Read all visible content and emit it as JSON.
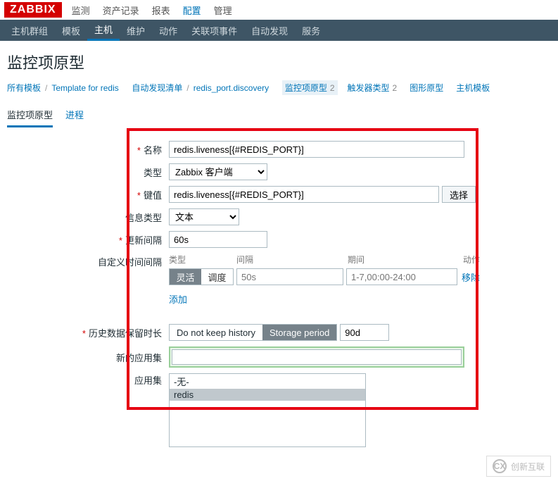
{
  "logo": "ZABBIX",
  "top_menu": [
    "监测",
    "资产记录",
    "报表",
    "配置",
    "管理"
  ],
  "top_menu_active": 3,
  "sub_menu": [
    "主机群组",
    "模板",
    "主机",
    "维护",
    "动作",
    "关联项事件",
    "自动发现",
    "服务"
  ],
  "sub_menu_active": 2,
  "page_title": "监控项原型",
  "breadcrumb": {
    "all_templates": "所有模板",
    "template": "Template for redis",
    "discovery_list": "自动发现清单",
    "discovery_rule": "redis_port.discovery",
    "pills": [
      {
        "label": "监控项原型",
        "count": "2",
        "active": true
      },
      {
        "label": "触发器类型",
        "count": "2",
        "active": false
      },
      {
        "label": "图形原型",
        "count": "",
        "active": false
      },
      {
        "label": "主机模板",
        "count": "",
        "active": false
      }
    ]
  },
  "tabs": [
    "监控项原型",
    "进程"
  ],
  "tabs_active": 0,
  "form": {
    "name_label": "名称",
    "name_value": "redis.liveness[{#REDIS_PORT}]",
    "type_label": "类型",
    "type_value": "Zabbix 客户端",
    "key_label": "键值",
    "key_value": "redis.liveness[{#REDIS_PORT}]",
    "key_select_btn": "选择",
    "info_type_label": "信息类型",
    "info_type_value": "文本",
    "update_interval_label": "更新间隔",
    "update_interval_value": "60s",
    "custom_interval_label": "自定义时间间隔",
    "interval_headers": {
      "type": "类型",
      "interval": "间隔",
      "period": "期间",
      "action": "动作"
    },
    "interval_row": {
      "flexible": "灵活",
      "scheduling": "调度",
      "interval_placeholder": "50s",
      "period_placeholder": "1-7,00:00-24:00",
      "remove": "移除"
    },
    "add_link": "添加",
    "history_label": "历史数据保留时长",
    "history_do_not_keep": "Do not keep history",
    "history_storage_period": "Storage period",
    "history_value": "90d",
    "new_app_label": "新的应用集",
    "app_label": "应用集",
    "app_options": [
      "-无-",
      "redis"
    ]
  },
  "watermark": {
    "icon": "CX",
    "text": "创新互联"
  }
}
